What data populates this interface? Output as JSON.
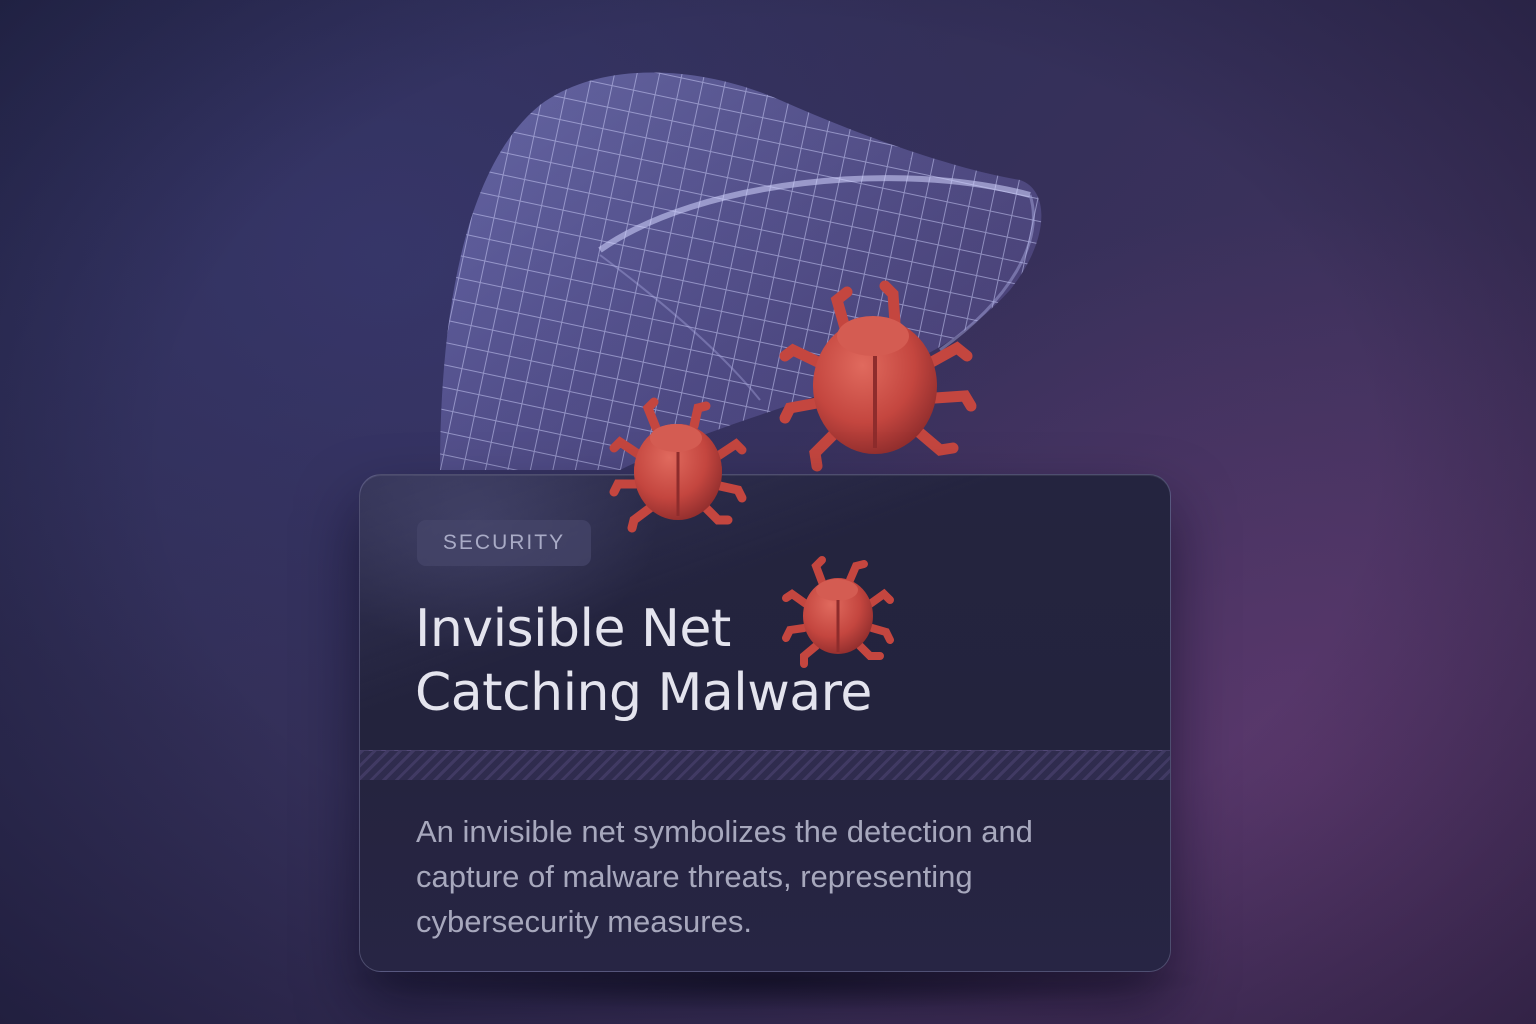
{
  "card": {
    "tag": "SECURITY",
    "title_line1": "Invisible Net",
    "title_line2": "Catching Malware",
    "description": "An invisible net symbolizes the detection and capture of malware threats, representing cybersecurity measures."
  },
  "illustration": {
    "net_icon": "net-icon",
    "bug_icon": "bug-icon",
    "bug_count": 3,
    "colors": {
      "net": "#9a9ae0",
      "bug": "#c8463f",
      "background": "#33305a"
    }
  }
}
